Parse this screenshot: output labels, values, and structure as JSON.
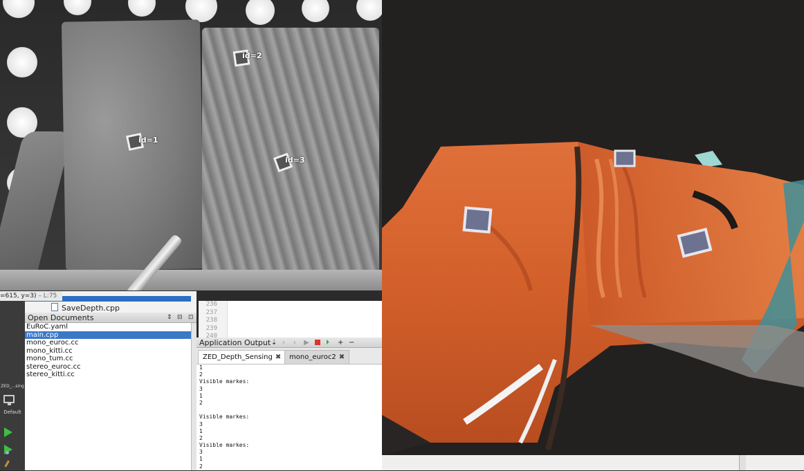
{
  "camera_view": {
    "markers": [
      {
        "label": "id=1"
      },
      {
        "label": "id=2"
      },
      {
        "label": "id=3"
      }
    ]
  },
  "ide": {
    "coords_text": "=615, y=3)",
    "coords_suffix": " – L:75",
    "mode_bar": {
      "project_label": "ZED_...sing",
      "kit_label": "Default",
      "icons": [
        "monitor-icon",
        "run-icon",
        "debug-run-icon",
        "build-icon"
      ]
    },
    "project_tree": {
      "visible_item": "SaveDepth.cpp"
    },
    "open_documents": {
      "title": "Open Documents",
      "controls": [
        "⇕",
        "⊟",
        "⊡"
      ],
      "items": [
        {
          "label": "EuRoC.yaml",
          "selected": false
        },
        {
          "label": "main.cpp",
          "selected": true
        },
        {
          "label": "mono_euroc.cc",
          "selected": false
        },
        {
          "label": "mono_kitti.cc",
          "selected": false
        },
        {
          "label": "mono_tum.cc",
          "selected": false
        },
        {
          "label": "stereo_euroc.cc",
          "selected": false
        },
        {
          "label": "stereo_kitti.cc",
          "selected": false
        }
      ]
    },
    "editor": {
      "line_numbers": [
        "236",
        "237",
        "238",
        "239",
        "240"
      ]
    },
    "application_output": {
      "title": "Application Output",
      "toolbar_icons": [
        "⇣",
        "‹",
        "›",
        "▶",
        "■",
        "⏵",
        "+",
        "−"
      ],
      "tabs": [
        {
          "label": "ZED_Depth_Sensing",
          "active": true,
          "close": "✖"
        },
        {
          "label": "mono_euroc2",
          "active": false,
          "close": "✖"
        }
      ],
      "lines": [
        "1",
        "2",
        "Visible markes:",
        "3",
        "1",
        "2",
        "",
        "Visible markes:",
        "3",
        "1",
        "2",
        "Visible markes:",
        "3",
        "1",
        "2"
      ]
    }
  },
  "colors": {
    "selection": "#3a78c8",
    "run_green": "#3fbf3f",
    "stop_red": "#dd3333",
    "clay_orange": "#d9652e"
  }
}
